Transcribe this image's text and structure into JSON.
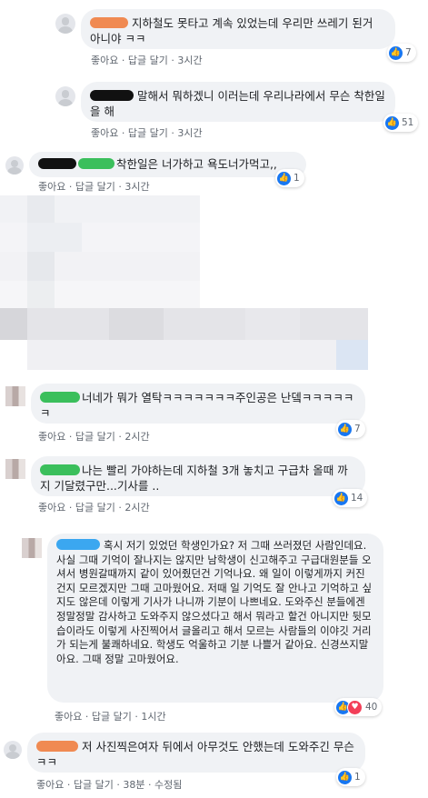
{
  "actions": {
    "like": "좋아요",
    "reply": "답글 달기",
    "sep": "·",
    "edited": "수정됨"
  },
  "comments": [
    {
      "text": "지하철도 못타고 계속 있었는데 우리만 쓰레기 된거 아니야 ㅋㅋ",
      "time": "3시간",
      "likes": "7"
    },
    {
      "text": "말해서 뭐하겠니 이러는데 우리나라에서 무슨 착한일을 해",
      "time": "3시간",
      "likes": "51"
    },
    {
      "text": "착한일은 너가하고 욕도너가먹고,,",
      "time": "3시간",
      "likes": "1"
    },
    {
      "text": "너네가 뭐가 열탁ㅋㅋㅋㅋㅋㅋㅋ주인공은 난뎈ㅋㅋㅋㅋㅋㅋ",
      "time": "2시간",
      "likes": "7"
    },
    {
      "text": "나는 빨리 가야하는데 지하철 3개 놓치고 구급차 올때 까지 기달렸구만...기사를 ..",
      "time": "2시간",
      "likes": "14"
    },
    {
      "text": "혹시 저기 있었던 학생인가요? 저 그때 쓰러졌던 사람인데요. 사실 그때 기억이 잘나지는 않지만 남학생이 신고해주고 구급대원분들 오셔서 병원갈때까지 같이 있어줬던건 기억나요. 왜 일이 이렇게까지 커진건지 모르겠지만 그때 고마웠어요. 저때 일 기억도 잘 안나고 기억하고 싶지도 않은데 이렇게 기사가 나니까 기분이 나쁘네요. 도와주신 분들에겐 정말정말 감사하고 도와주지 않으셨다고 해서 뭐라고 할건 아니지만 뒷모습이라도 이렇게 사진찍어서 글올리고 해서 모르는 사람들의 이야깃 거리가 되는게 불쾌하네요. 학생도 억울하고 기분 나쁠거 같아요. 신경쓰지말아요. 그때 정말 고마웠어요.",
      "time": "1시간",
      "likes": "40"
    },
    {
      "text": "저 사진찍은여자 뒤에서 아무것도 안했는데 도와주긴 무슨ㅋㅋ",
      "time": "38분",
      "likes": "1"
    }
  ]
}
